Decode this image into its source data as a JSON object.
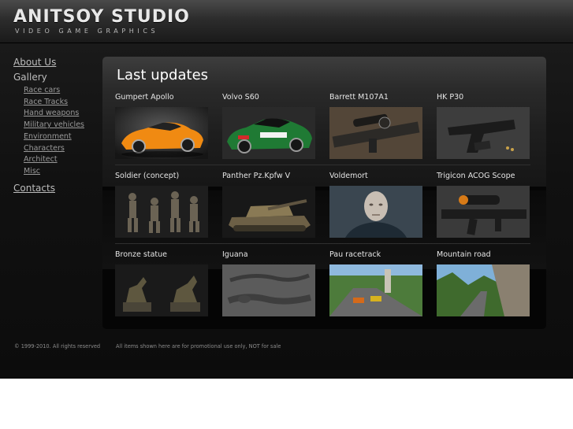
{
  "logo": {
    "title": "ANITSOY STUDIO",
    "subtitle": "VIDEO GAME GRAPHICS"
  },
  "sidebar": {
    "about_label": "About Us",
    "gallery_label": "Gallery",
    "gallery_items": [
      {
        "label": "Race cars"
      },
      {
        "label": "Race Tracks"
      },
      {
        "label": "Hand weapons"
      },
      {
        "label": "Military vehicles"
      },
      {
        "label": "Environment"
      },
      {
        "label": "Characters"
      },
      {
        "label": "Architect"
      },
      {
        "label": "Misc"
      }
    ],
    "contacts_label": "Contacts"
  },
  "main": {
    "title": "Last updates",
    "items": [
      {
        "title": "Gumpert Apollo",
        "thumb": "orange-sports-car"
      },
      {
        "title": "Volvo S60",
        "thumb": "green-race-car"
      },
      {
        "title": "Barrett M107A1",
        "thumb": "sniper-rifle"
      },
      {
        "title": "HK P30",
        "thumb": "pistol"
      },
      {
        "title": "Soldier (concept)",
        "thumb": "soldier-figures"
      },
      {
        "title": "Panther Pz.Kpfw V",
        "thumb": "tank"
      },
      {
        "title": "Voldemort",
        "thumb": "character-head"
      },
      {
        "title": "Trigicon ACOG Scope",
        "thumb": "rifle-scope"
      },
      {
        "title": "Bronze statue",
        "thumb": "horse-statues"
      },
      {
        "title": "Iguana",
        "thumb": "iguana"
      },
      {
        "title": "Pau racetrack",
        "thumb": "race-track"
      },
      {
        "title": "Mountain road",
        "thumb": "mountain-road"
      }
    ]
  },
  "footer": {
    "copyright": "© 1999-2010. All rights reserved",
    "disclaimer": "All items shown here are for promotional use only, NOT for sale"
  }
}
